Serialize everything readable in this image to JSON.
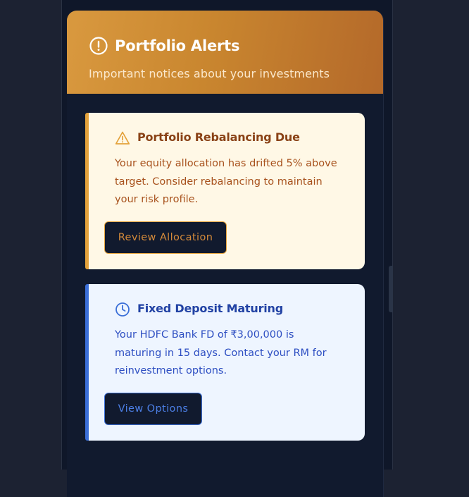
{
  "header": {
    "title": "Portfolio Alerts",
    "subtitle": "Important notices about your investments",
    "icon": "alert-circle-icon"
  },
  "alerts": [
    {
      "type": "warning",
      "icon": "warning-triangle-icon",
      "title": "Portfolio Rebalancing Due",
      "body": "Your equity allocation has drifted 5% above target. Consider rebalancing to maintain your risk profile.",
      "button": "Review Allocation",
      "accent": "#e4a23b"
    },
    {
      "type": "info",
      "icon": "clock-icon",
      "title": "Fixed Deposit Maturing",
      "body": "Your HDFC Bank FD of ₹3,00,000 is maturing in 15 days. Contact your RM for reinvestment options.",
      "button": "View Options",
      "accent": "#3b6fd8"
    }
  ]
}
